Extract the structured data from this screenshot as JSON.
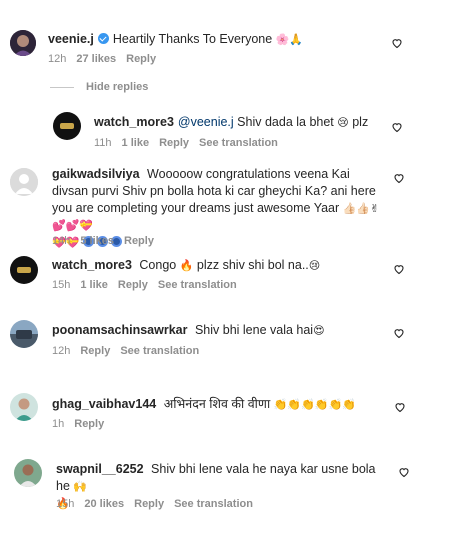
{
  "comments": [
    {
      "username": "veenie.j",
      "text": "Heartily Thanks To Everyone",
      "emojis": "🌸🙏",
      "time": "12h",
      "likes": "27 likes",
      "reply": "Reply"
    },
    {
      "username": "watch_more3",
      "mention": "@veenie.j",
      "text": "Shiv dada la bhet",
      "emojis": "😢",
      "text_after": "plz",
      "time": "11h",
      "likes": "1 like",
      "reply": "Reply",
      "see_translation": "See translation"
    },
    {
      "username": "gaikwadsilviya",
      "text": "Wooooow congratulations veena Kai divsan purvi Shiv pn bolla hota ki car gheychi Ka? ani here you are completing your dreams just awesome Yaar",
      "emojis_line1": "👍🏻👍🏻✌💕💕💝",
      "emojis_line2": "💝💝",
      "time": "14h",
      "likes": "5 likes",
      "reply": "Reply"
    },
    {
      "username": "watch_more3",
      "text": "Congo",
      "emojis": "🔥",
      "text_after": "plzz shiv shi bol na..",
      "emojis_after": "😢",
      "time": "15h",
      "likes": "1 like",
      "reply": "Reply",
      "see_translation": "See translation"
    },
    {
      "username": "poonamsachinsawrkar",
      "text": "Shiv bhi lene vala hai",
      "emojis": "😍",
      "time": "12h",
      "reply": "Reply",
      "see_translation": "See translation"
    },
    {
      "username": "ghag_vaibhav144",
      "text": "अभिनंदन शिव की वीणा",
      "emojis": "👏👏👏👏👏👏",
      "time": "1h",
      "reply": "Reply"
    },
    {
      "username": "swapnil__6252",
      "text": "Shiv bhi lene vala he naya kar usne bola he",
      "emojis": "🙌",
      "emojis_line2": "🔥",
      "time": "15h",
      "likes": "20 likes",
      "reply": "Reply",
      "see_translation": "See translation"
    }
  ],
  "hide_replies": "Hide replies",
  "icons": [
    "heart-icon",
    "verified-badge-icon"
  ],
  "colors": {
    "text": "#262626",
    "meta": "#8e8e8e",
    "mention": "#00376b",
    "verified": "#3897f0"
  }
}
